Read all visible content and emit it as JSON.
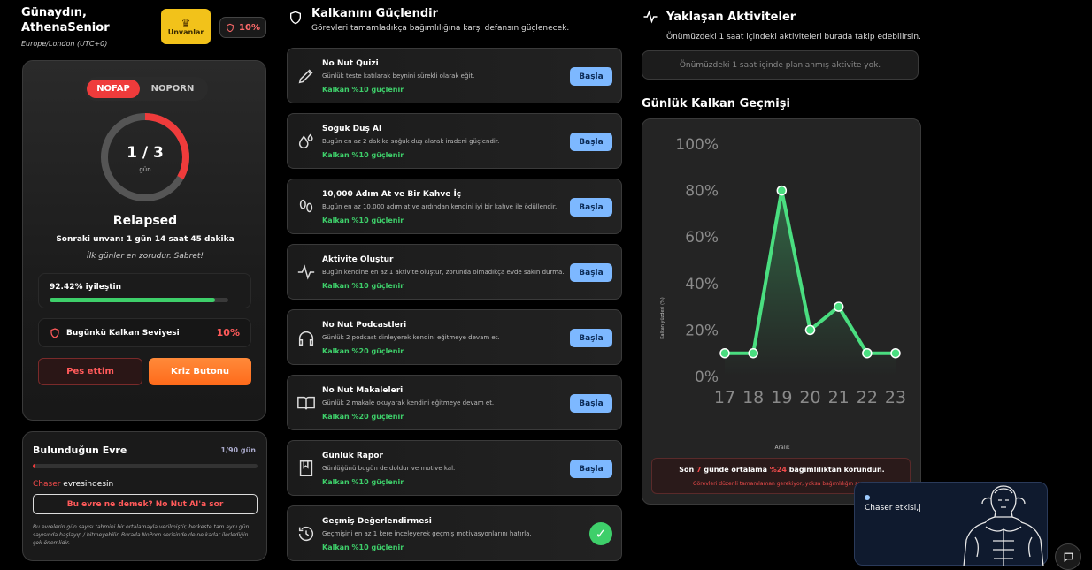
{
  "header": {
    "greeting_line1": "Günaydın,",
    "greeting_line2": "AthenaSenior",
    "timezone": "Europe/London (UTC+0)",
    "titles_button": "Unvanlar",
    "shield_percent": "10%"
  },
  "main_card": {
    "toggle_active": "NOFAP",
    "toggle_inactive": "NOPORN",
    "ring_value": "1 / 3",
    "ring_unit": "gün",
    "ring_progress": 0.333,
    "status": "Relapsed",
    "next_title": "Sonraki unvan: 1 gün 14 saat 45 dakika",
    "quote": "İlk günler en zorudur. Sabret!",
    "improvement_label": "92.42% iyileştin",
    "improvement_value": 92.42,
    "shield_label": "Bugünkü Kalkan Seviyesi",
    "shield_value": "10%",
    "give_up_button": "Pes ettim",
    "crisis_button": "Kriz Butonu"
  },
  "stage": {
    "title": "Bulunduğun Evre",
    "days": "1/90 gün",
    "progress": 0.011,
    "name": "Chaser",
    "name_suffix": " evresindesin",
    "ask_button": "Bu evre ne demek? No Nut AI'a sor",
    "note": "Bu evrelerin gün sayısı tahmini bir ortalamayla verilmiştir, herkeste tam aynı gün sayısında başlayıp / bitmeyebilir. Burada NoPorn serisinde de ne kadar ilerlediğin çok önemlidir."
  },
  "tasks_section": {
    "title": "Kalkanını Güçlendir",
    "subtitle": "Görevleri tamamladıkça bağımlılığına karşı defansın güçlenecek.",
    "start_label": "Başla",
    "tasks": [
      {
        "title": "No Nut Quizi",
        "desc": "Günlük teste katılarak beynini sürekli olarak eğit.",
        "bonus": "Kalkan %10 güçlenir",
        "icon": "pencil-icon",
        "done": false
      },
      {
        "title": "Soğuk Duş Al",
        "desc": "Bugün en az 2 dakika soğuk duş alarak iradeni güçlendir.",
        "bonus": "Kalkan %10 güçlenir",
        "icon": "water-drops-icon",
        "done": false
      },
      {
        "title": "10,000 Adım At ve Bir Kahve İç",
        "desc": "Bugün en az 10,000 adım at ve ardından kendini iyi bir kahve ile ödüllendir.",
        "bonus": "Kalkan %10 güçlenir",
        "icon": "footprints-icon",
        "done": false
      },
      {
        "title": "Aktivite Oluştur",
        "desc": "Bugün kendine en az 1 aktivite oluştur, zorunda olmadıkça evde sakın durma.",
        "bonus": "Kalkan %10 güçlenir",
        "icon": "activity-pulse-icon",
        "done": false
      },
      {
        "title": "No Nut Podcastleri",
        "desc": "Günlük 2 podcast dinleyerek kendini eğitmeye devam et.",
        "bonus": "Kalkan %20 güçlenir",
        "icon": "headphones-icon",
        "done": false
      },
      {
        "title": "No Nut Makaleleri",
        "desc": "Günlük 2 makale okuyarak kendini eğitmeye devam et.",
        "bonus": "Kalkan %20 güçlenir",
        "icon": "open-book-icon",
        "done": false
      },
      {
        "title": "Günlük Rapor",
        "desc": "Günlüğünü bugün de doldur ve motive kal.",
        "bonus": "Kalkan %10 güçlenir",
        "icon": "journal-icon",
        "done": false
      },
      {
        "title": "Geçmiş Değerlendirmesi",
        "desc": "Geçmişini en az 1 kere inceleyerek geçmiş motivasyonlarını hatırla.",
        "bonus": "Kalkan %10 güçlenir",
        "icon": "history-icon",
        "done": true
      }
    ]
  },
  "activities": {
    "title": "Yaklaşan Aktiviteler",
    "subtitle": "Önümüzdeki 1 saat içindeki aktiviteleri burada takip edebilirsin.",
    "empty": "Önümüzdeki 1 saat içinde planlanmış aktivite yok."
  },
  "history": {
    "title": "Günlük Kalkan Geçmişi",
    "note_prefix": "Son ",
    "note_days": "7",
    "note_mid": " günde ortalama ",
    "note_avg": "%24",
    "note_suffix": " bağımlılıktan korundun.",
    "note_warning": "Görevleri düzenli tamamlaman gerekiyor, yoksa bağımlılığın seni..."
  },
  "chart_data": {
    "type": "line",
    "x": [
      "17",
      "18",
      "19",
      "20",
      "21",
      "22",
      "23"
    ],
    "values": [
      10,
      10,
      80,
      20,
      30,
      10,
      10
    ],
    "ylabel": "Kalkan yüzdesi (%)",
    "xlabel": "Aralık",
    "yticks": [
      "0%",
      "20%",
      "40%",
      "60%",
      "80%",
      "100%"
    ],
    "ylim": [
      0,
      100
    ],
    "grid": false,
    "line_color": "#4ade80"
  },
  "chat": {
    "text": "Chaser etkisi,|"
  }
}
